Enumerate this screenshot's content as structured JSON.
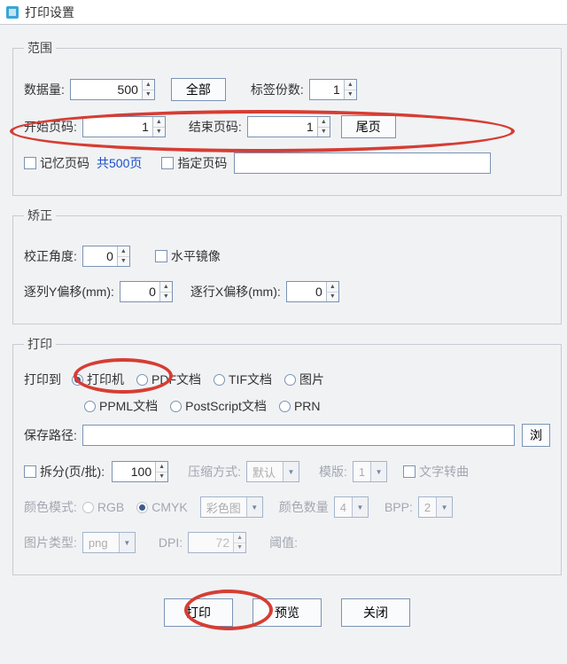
{
  "title": "打印设置",
  "range": {
    "legend": "范围",
    "dataCountLabel": "数据量:",
    "dataCountValue": "500",
    "allBtn": "全部",
    "copiesLabel": "标签份数:",
    "copiesValue": "1",
    "startPageLabel": "开始页码:",
    "startPageValue": "1",
    "endPageLabel": "结束页码:",
    "endPageValue": "1",
    "lastPageBtn": "尾页",
    "rememberPage": "记忆页码",
    "totalPages": "共500页",
    "specifyPage": "指定页码"
  },
  "correct": {
    "legend": "矫正",
    "angleLabel": "校正角度:",
    "angleValue": "0",
    "mirror": "水平镜像",
    "colYOffsetLabel": "逐列Y偏移(mm):",
    "colYOffsetValue": "0",
    "rowXOffsetLabel": "逐行X偏移(mm):",
    "rowXOffsetValue": "0"
  },
  "print": {
    "legend": "打印",
    "printToLabel": "打印到",
    "printer": "打印机",
    "pdf": "PDF文档",
    "tif": "TIF文档",
    "image": "图片",
    "ppml": "PPML文档",
    "postscript": "PostScript文档",
    "prn": "PRN",
    "savePathLabel": "保存路径:",
    "browseBtn": "浏",
    "splitLabel": "拆分(页/批):",
    "splitValue": "100",
    "compressLabel": "压缩方式:",
    "compressValue": "默认",
    "templateLabel": "模版:",
    "templateValue": "1",
    "textRotate": "文字转曲",
    "colorModeLabel": "颜色模式:",
    "rgb": "RGB",
    "cmyk": "CMYK",
    "colorCombo": "彩色图",
    "colorCountLabel": "颜色数量",
    "colorCountValue": "4",
    "bppLabel": "BPP:",
    "bppValue": "2",
    "imgTypeLabel": "图片类型:",
    "imgTypeValue": "png",
    "dpiLabel": "DPI:",
    "dpiValue": "72",
    "thresholdLabel": "阈值:"
  },
  "footer": {
    "print": "打印",
    "preview": "预览",
    "close": "关闭"
  }
}
